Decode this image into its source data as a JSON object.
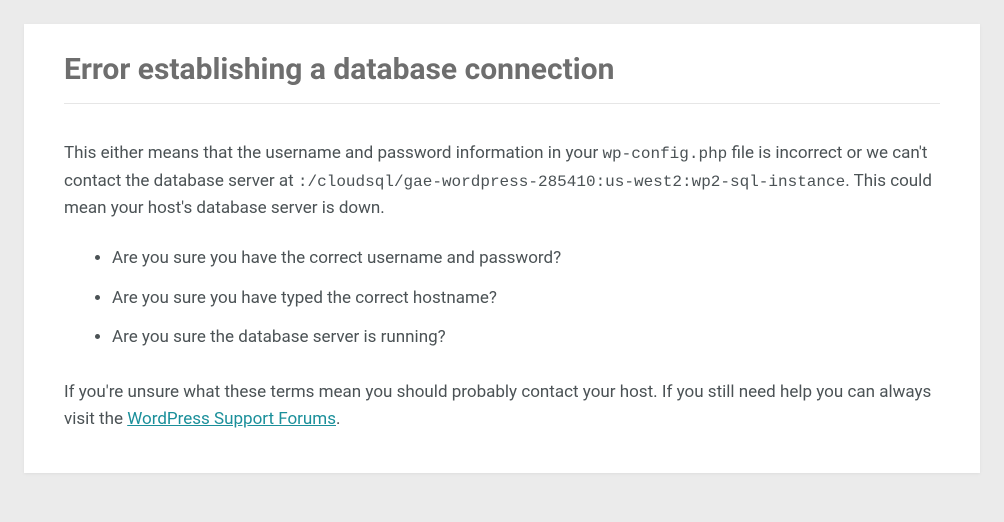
{
  "heading": "Error establishing a database connection",
  "intro": {
    "part1": "This either means that the username and password information in your ",
    "code1": "wp-config.php",
    "part2": " file is incorrect or we can't contact the database server at ",
    "code2": ":/cloudsql/gae-wordpress-285410:us-west2:wp2-sql-instance",
    "part3": ". This could mean your host's database server is down."
  },
  "checklist": [
    "Are you sure you have the correct username and password?",
    "Are you sure you have typed the correct hostname?",
    "Are you sure the database server is running?"
  ],
  "outro": {
    "part1": "If you're unsure what these terms mean you should probably contact your host. If you still need help you can always visit the ",
    "link_text": "WordPress Support Forums",
    "part2": "."
  }
}
